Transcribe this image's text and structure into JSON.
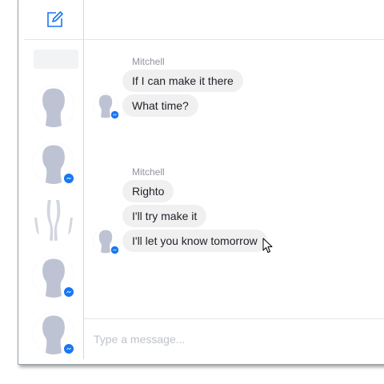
{
  "composer": {
    "placeholder": "Type a message..."
  },
  "conversation": {
    "groups": [
      {
        "sender": "Mitchell",
        "messages": [
          "If I can make it there",
          "What time?"
        ]
      },
      {
        "sender": "Mitchell",
        "messages": [
          "Righto",
          "I'll try make it",
          "I'll let you know tomorrow"
        ]
      }
    ]
  },
  "icons": {
    "compose": "compose-icon",
    "messenger_badge": "messenger-badge-icon",
    "avatar": "default-avatar-icon",
    "cursor": "mouse-pointer-icon"
  },
  "colors": {
    "accent": "#1877f2",
    "bubble": "#f1f0f0",
    "avatar": "#bec3d4",
    "sender": "#90949c"
  }
}
